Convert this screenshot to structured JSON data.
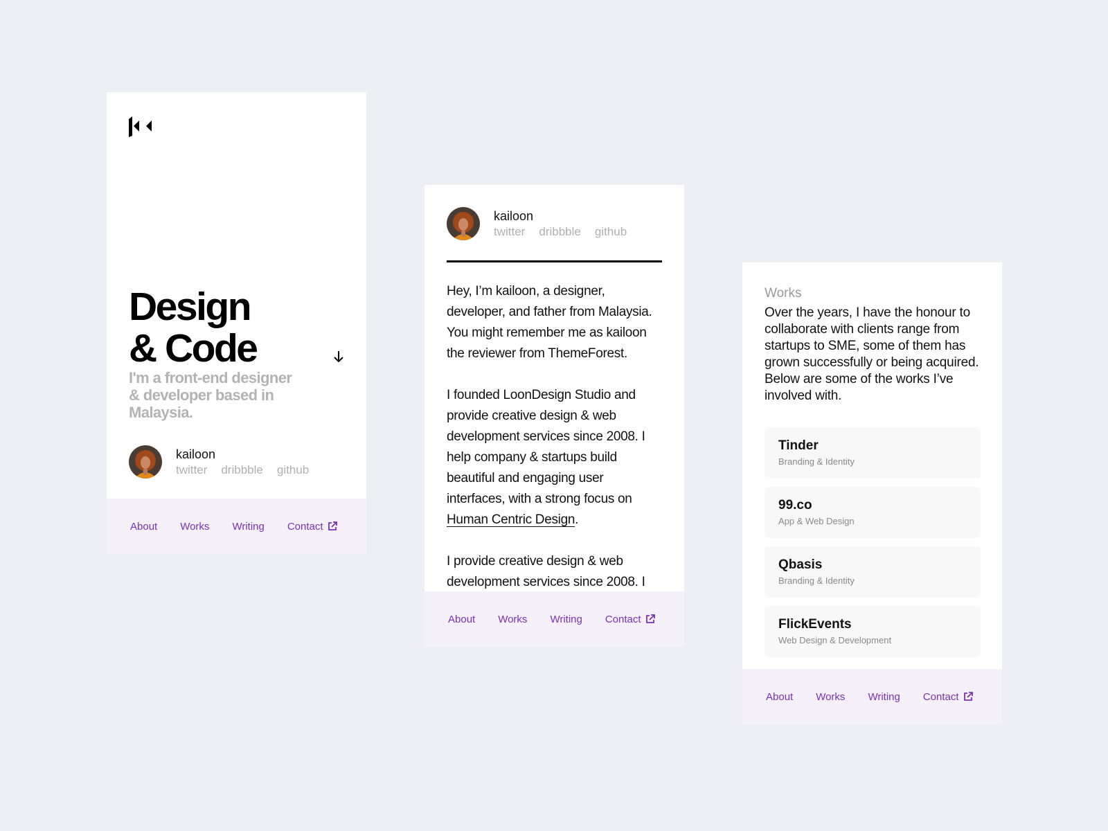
{
  "nav": {
    "about": "About",
    "works": "Works",
    "writing": "Writing",
    "contact": "Contact"
  },
  "profile": {
    "name": "kailoon",
    "twitter": "twitter",
    "dribbble": "dribbble",
    "github": "github"
  },
  "hero": {
    "title_line1": "Design",
    "title_line2": "& Code",
    "subtitle": "I'm a front-end designer & developer based in Malaysia."
  },
  "about": {
    "p1": "Hey, I’m kailoon, a designer, developer, and father from Malaysia. You might remember me as kailoon the reviewer from ThemeForest.",
    "p2_text": "I founded LoonDesign Studio and provide creative design & web development services since 2008. I help company & startups build beautiful and engaging user interfaces, with a strong focus on ",
    "p2_link": "Human Centric Design",
    "p2_end": ".",
    "p3": "I provide creative design & web development services since 2008. I"
  },
  "works": {
    "label": "Works",
    "intro": "Over the years, I have the honour to collaborate with clients range from startups to SME, some of them has grown successfully or being acquired. Below are some of the works I’ve involved with.",
    "items": [
      {
        "name": "Tinder",
        "category": "Branding & Identity"
      },
      {
        "name": "99.co",
        "category": "App & Web Design"
      },
      {
        "name": "Qbasis",
        "category": "Branding & Identity"
      },
      {
        "name": "FlickEvents",
        "category": "Web Design & Development"
      }
    ]
  }
}
